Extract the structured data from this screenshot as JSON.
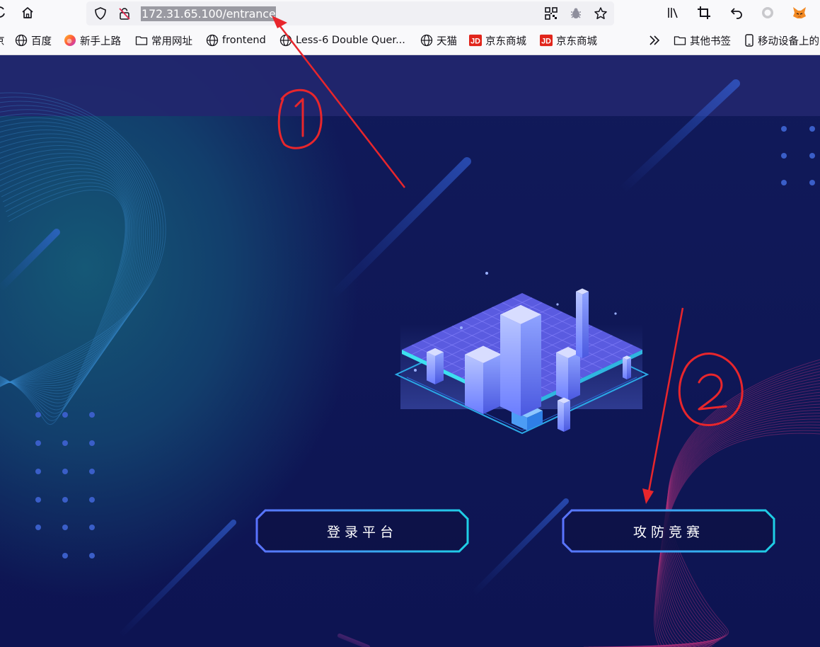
{
  "browser": {
    "url": "172.31.65.100/entrance",
    "toolbar_icons": [
      "reload-icon",
      "home-icon",
      "shield-icon",
      "insecure-lock-icon",
      "qr-code-icon",
      "bug-icon",
      "star-icon",
      "library-icon",
      "crop-icon",
      "undo-icon",
      "circle-icon",
      "fox-icon"
    ]
  },
  "bookmarks": [
    {
      "label": "京",
      "icon": "globe-icon"
    },
    {
      "label": "百度",
      "icon": "globe-icon"
    },
    {
      "label": "新手上路",
      "icon": "firefox-icon"
    },
    {
      "label": "常用网址",
      "icon": "folder-icon"
    },
    {
      "label": "frontend",
      "icon": "globe-icon"
    },
    {
      "label": "Less-6 Double Quer...",
      "icon": "globe-icon"
    },
    {
      "label": "天猫",
      "icon": "globe-icon"
    },
    {
      "label": "京东商城",
      "icon": "jd-icon"
    },
    {
      "label": "京东商城",
      "icon": "jd-icon"
    },
    {
      "label": "其他书签",
      "icon": "folder-icon"
    },
    {
      "label": "移动设备上的",
      "icon": "mobile-icon"
    }
  ],
  "page": {
    "buttons": [
      {
        "label": "登录平台"
      },
      {
        "label": "攻防竞赛"
      }
    ]
  },
  "annotations": {
    "marker_1": "①",
    "marker_2": "②",
    "color": "#e8262c"
  },
  "colors": {
    "background": "#0d1452",
    "header_band": "#22266e",
    "button_border_start": "#5a73ff",
    "button_border_end": "#1ecfe6"
  }
}
